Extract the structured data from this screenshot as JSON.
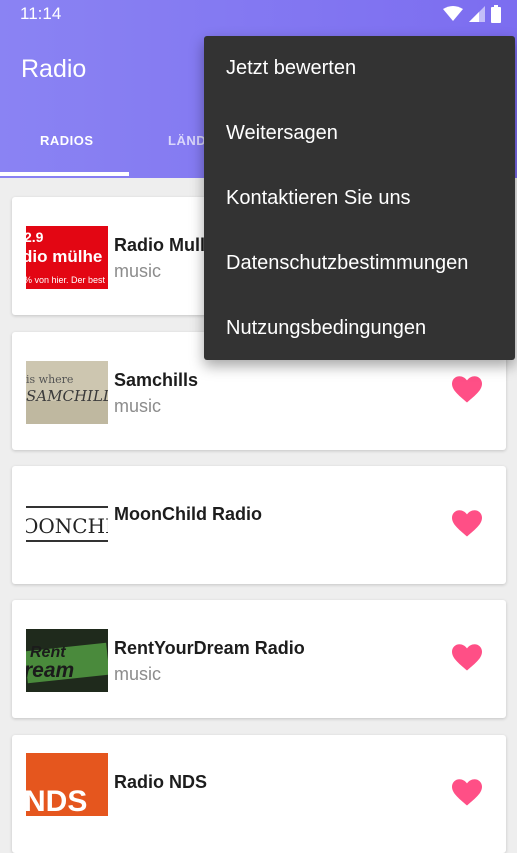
{
  "status": {
    "time": "11:14"
  },
  "app": {
    "title": "Radio"
  },
  "tabs": [
    {
      "label": "RADIOS"
    },
    {
      "label": "LÄND"
    }
  ],
  "stations": [
    {
      "name": "Radio Mull",
      "genre": "music",
      "thumb_text_1": "2.9",
      "thumb_text_2": "dio mülhe",
      "thumb_text_3": "% von hier. Der best"
    },
    {
      "name": "Samchills",
      "genre": "music",
      "thumb_text_1": "is where",
      "thumb_text_2": "SAMCHILL"
    },
    {
      "name": "MoonChild Radio",
      "genre": "",
      "thumb_text_1": "OONCHILD"
    },
    {
      "name": "RentYourDream Radio",
      "genre": "music",
      "thumb_text_1": "Rent",
      "thumb_text_2": "ream"
    },
    {
      "name": "Radio NDS",
      "genre": "",
      "thumb_text_1": "NDS"
    }
  ],
  "menu": {
    "items": [
      "Jetzt bewerten",
      "Weitersagen",
      "Kontaktieren Sie uns",
      "Datenschutzbestimmungen",
      "Nutzungsbedingungen"
    ]
  },
  "colors": {
    "accent": "#7c6df0",
    "heart": "#ff4f86",
    "menu_bg": "#333333"
  }
}
